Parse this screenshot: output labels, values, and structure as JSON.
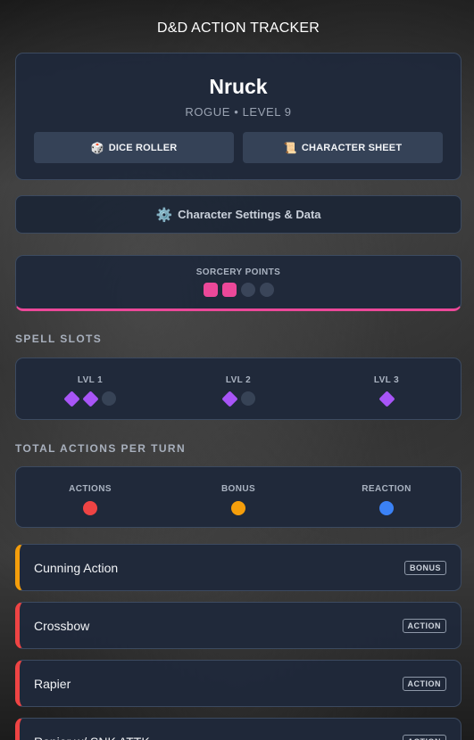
{
  "app": {
    "title": "D&D ACTION TRACKER"
  },
  "character": {
    "name": "Nruck",
    "subtitle": "ROGUE • LEVEL 9",
    "dice_roller_label": "DICE ROLLER",
    "dice_roller_icon": "🎲",
    "sheet_label": "CHARACTER SHEET",
    "sheet_icon": "📜"
  },
  "settings": {
    "label": "Character Settings & Data",
    "icon": "⚙️"
  },
  "sorcery": {
    "label": "SORCERY POINTS",
    "total": 4,
    "used": 2,
    "color": "#ec4899"
  },
  "spell_slots": {
    "section_label": "SPELL SLOTS",
    "color": "#a855f7",
    "levels": [
      {
        "label": "LVL 1",
        "total": 3,
        "available": 2
      },
      {
        "label": "LVL 2",
        "total": 2,
        "available": 1
      },
      {
        "label": "LVL 3",
        "total": 1,
        "available": 1
      }
    ]
  },
  "actions_per_turn": {
    "section_label": "TOTAL ACTIONS PER TURN",
    "types": [
      {
        "label": "ACTIONS",
        "color": "#ef4444"
      },
      {
        "label": "BONUS",
        "color": "#f59e0b"
      },
      {
        "label": "REACTION",
        "color": "#3b82f6"
      }
    ]
  },
  "abilities": [
    {
      "name": "Cunning Action",
      "tag": "BONUS",
      "color": "#f59e0b"
    },
    {
      "name": "Crossbow",
      "tag": "ACTION",
      "color": "#ef4444"
    },
    {
      "name": "Rapier",
      "tag": "ACTION",
      "color": "#ef4444"
    },
    {
      "name": "Rapier w/ SNK ATTK",
      "tag": "ACTION",
      "color": "#ef4444"
    }
  ]
}
